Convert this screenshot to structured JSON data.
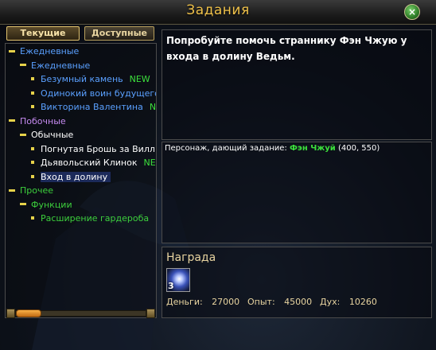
{
  "window": {
    "title": "Задания",
    "close_glyph": "×"
  },
  "tabs": [
    {
      "label": "Текущие",
      "active": true
    },
    {
      "label": "Доступные",
      "active": false
    }
  ],
  "tree": [
    {
      "label": "Ежедневные",
      "kind": "category",
      "color": "#5aa0ff"
    },
    {
      "label": "Ежедневные",
      "kind": "group",
      "color": "#5aa0ff"
    },
    {
      "label": "Безумный камень",
      "kind": "quest",
      "color": "#5aa0ff",
      "badge": "NEW"
    },
    {
      "label": "Одинокий воин будущего",
      "kind": "quest",
      "color": "#5aa0ff",
      "badge": ""
    },
    {
      "label": "Викторина Валентина",
      "kind": "quest",
      "color": "#5aa0ff",
      "badge": "NE"
    },
    {
      "label": "Побочные",
      "kind": "category",
      "color": "#c58af0"
    },
    {
      "label": "Обычные",
      "kind": "group",
      "color": "#ffffff"
    },
    {
      "label": "Погнутая Брошь за Вилл",
      "kind": "quest",
      "color": "#ffffff",
      "badge": ""
    },
    {
      "label": "Дьявольский Клинок",
      "kind": "quest",
      "color": "#ffffff",
      "badge": "NEW"
    },
    {
      "label": "Вход в долину",
      "kind": "quest",
      "color": "#ffffff",
      "badge": "",
      "selected": true
    },
    {
      "label": "Прочее",
      "kind": "category",
      "color": "#3ccf3c"
    },
    {
      "label": "Функции",
      "kind": "group",
      "color": "#3ccf3c"
    },
    {
      "label": "Расширение гардероба",
      "kind": "quest",
      "color": "#3ccf3c",
      "badge": ""
    }
  ],
  "badge_color": "#3ce03c",
  "description": "Попробуйте помочь страннику Фэн Чжую у входа в долину Ведьм.",
  "giver": {
    "label": "Персонаж, дающий задание:",
    "name": "Фэн Чжуй",
    "coords": "(400, 550)",
    "name_color": "#3ce03c"
  },
  "reward": {
    "title": "Награда",
    "item_count": "3",
    "item_icon": "crystal-orb-icon",
    "money_label": "Деньги:",
    "money": "27000",
    "exp_label": "Опыт:",
    "exp": "45000",
    "spirit_label": "Дух:",
    "spirit": "10260"
  }
}
